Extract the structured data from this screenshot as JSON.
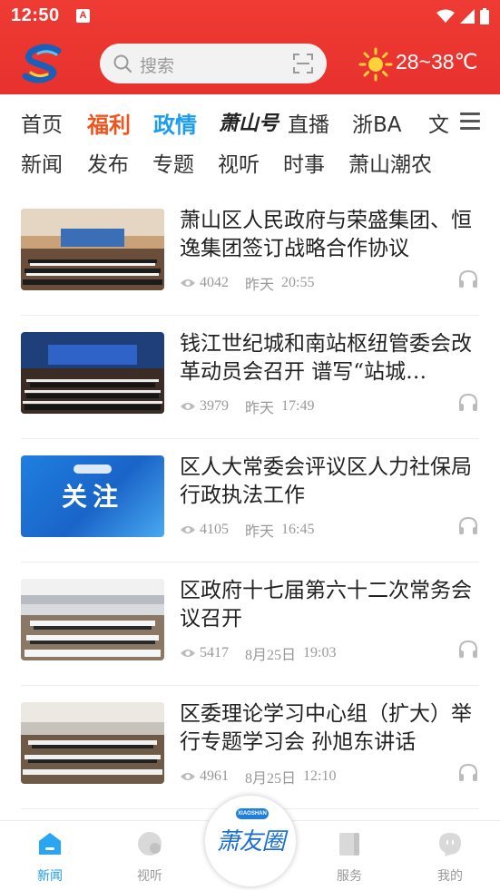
{
  "status_bar": {
    "time": "12:50",
    "app_badge": "A"
  },
  "header": {
    "search_placeholder": "搜索",
    "temperature": "28~38℃"
  },
  "channels_row1": [
    {
      "label": "首页"
    },
    {
      "label": "福利"
    },
    {
      "label": "政情"
    },
    {
      "label": "萧山号"
    },
    {
      "label": "直播"
    },
    {
      "label": "浙BA"
    },
    {
      "label": "文"
    }
  ],
  "channels_row2": [
    {
      "label": "新闻"
    },
    {
      "label": "发布"
    },
    {
      "label": "专题"
    },
    {
      "label": "视听"
    },
    {
      "label": "时事"
    },
    {
      "label": "萧山潮农"
    }
  ],
  "active_channel": "政情",
  "news": [
    {
      "title": "萧山区人民政府与荣盛集团、恒逸集团签订战略合作协议",
      "views": "4042",
      "date": "昨天",
      "time": "20:55"
    },
    {
      "title": "钱江世纪城和南站枢纽管委会改革动员会召开 谱写“站城…",
      "views": "3979",
      "date": "昨天",
      "time": "17:49"
    },
    {
      "title": "区人大常委会评议区人力社保局行政执法工作",
      "views": "4105",
      "date": "昨天",
      "time": "16:45",
      "thumb_text": "关注"
    },
    {
      "title": "区政府十七届第六十二次常务会议召开",
      "views": "5417",
      "date": "8月25日",
      "time": "19:03"
    },
    {
      "title": "区委理论学习中心组（扩大）举行专题学习会 孙旭东讲话",
      "views": "4961",
      "date": "8月25日",
      "time": "12:10"
    }
  ],
  "tabbar": {
    "tabs": [
      {
        "label": "新闻",
        "icon": "home-icon",
        "active": true
      },
      {
        "label": "视听",
        "icon": "video-icon",
        "active": false
      },
      {
        "label": "服务",
        "icon": "service-icon",
        "active": false
      },
      {
        "label": "我的",
        "icon": "profile-icon",
        "active": false
      }
    ],
    "center": {
      "label": "萧友圈",
      "pill": "XIAOSHAN"
    }
  },
  "colors": {
    "header": "#e8312e",
    "accent": "#1b9cf0",
    "welfare": "#f0541e"
  }
}
